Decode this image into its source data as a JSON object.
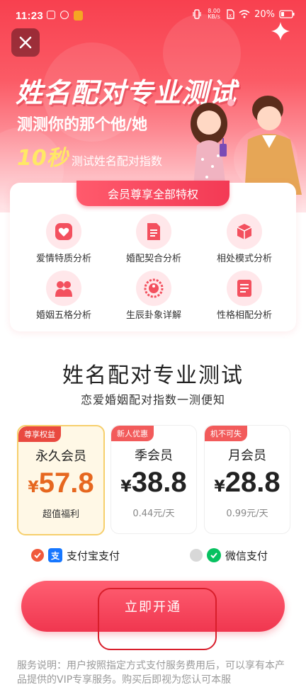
{
  "status_bar": {
    "time": "11:23",
    "net_speed": "8.00 KB/s",
    "battery": "20%"
  },
  "hero": {
    "title": "姓名配对专业测试",
    "subtitle": "测测你的那个他/她",
    "seconds": "10秒",
    "seconds_caption": "测试姓名配对指数"
  },
  "privileges": {
    "header": "会员尊享全部特权",
    "items": [
      {
        "label": "爱情特质分析",
        "icon": "heart-icon"
      },
      {
        "label": "婚配契合分析",
        "icon": "document-icon"
      },
      {
        "label": "相处模式分析",
        "icon": "cube-icon"
      },
      {
        "label": "婚姻五格分析",
        "icon": "couple-icon"
      },
      {
        "label": "生辰卦象详解",
        "icon": "bagua-icon"
      },
      {
        "label": "性格相配分析",
        "icon": "report-icon"
      }
    ]
  },
  "product": {
    "title": "姓名配对专业测试",
    "subtitle": "恋爱婚姻配对指数一测便知"
  },
  "plans": [
    {
      "badge": "尊享权益",
      "name": "永久会员",
      "currency": "¥",
      "price": "57.8",
      "note": "超值福利",
      "selected": true
    },
    {
      "badge": "新人优惠",
      "name": "季会员",
      "currency": "¥",
      "price": "38.8",
      "note": "0.44元/天",
      "selected": false
    },
    {
      "badge": "机不可失",
      "name": "月会员",
      "currency": "¥",
      "price": "28.8",
      "note": "0.99元/天",
      "selected": false
    }
  ],
  "payment": {
    "alipay": {
      "label": "支付宝支付",
      "logo": "支",
      "selected": true
    },
    "wechat": {
      "label": "微信支付",
      "selected": false
    }
  },
  "cta": {
    "label": "立即开通"
  },
  "terms": {
    "text": "服务说明：用户按照指定方式支付服务费用后，可以享有本产品提供的VIP专享服务。购买后即视为您认可本服"
  },
  "colors": {
    "primary": "#f33a55",
    "accent_price": "#e6671f",
    "gold_border": "#f6cf6c",
    "alipay": "#1677ff",
    "wechat": "#07c160"
  }
}
